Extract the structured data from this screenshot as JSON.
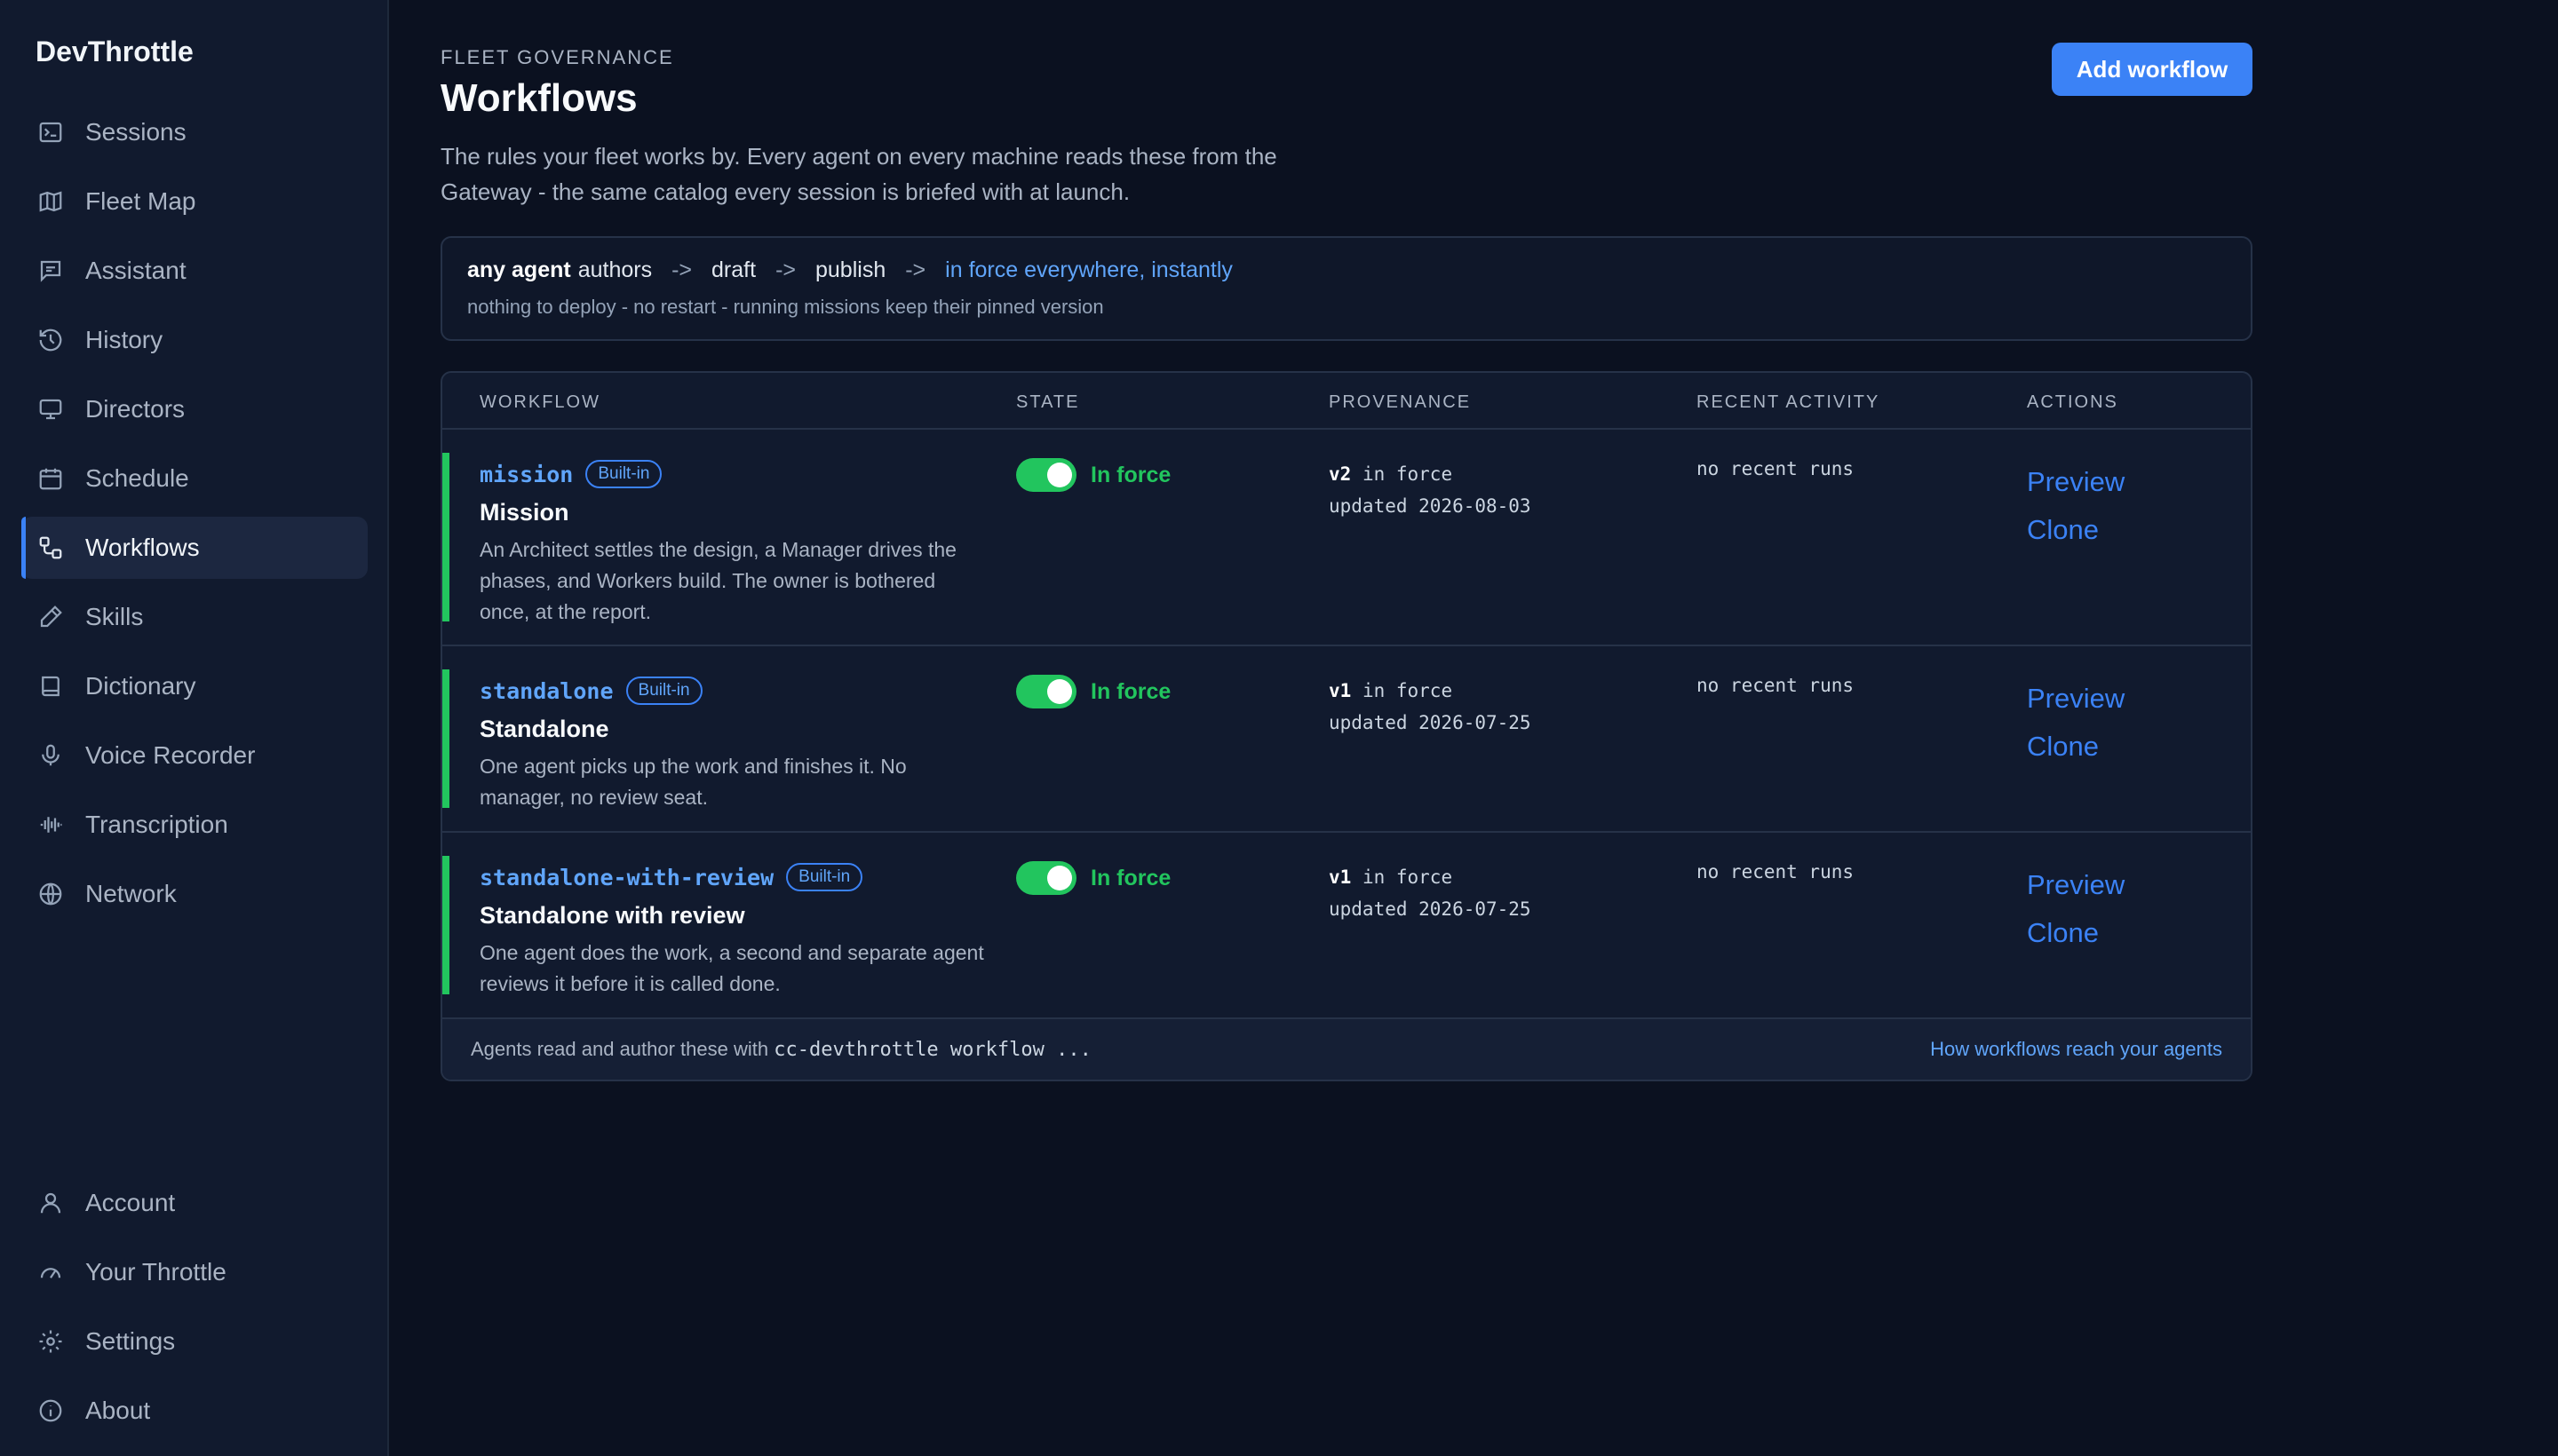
{
  "app": {
    "brand": "DevThrottle"
  },
  "sidebar": {
    "items": [
      {
        "label": "Sessions",
        "icon": "terminal-icon"
      },
      {
        "label": "Fleet Map",
        "icon": "map-icon"
      },
      {
        "label": "Assistant",
        "icon": "chat-icon"
      },
      {
        "label": "History",
        "icon": "history-icon"
      },
      {
        "label": "Directors",
        "icon": "monitor-icon"
      },
      {
        "label": "Schedule",
        "icon": "calendar-icon"
      },
      {
        "label": "Workflows",
        "icon": "workflow-icon",
        "active": true
      },
      {
        "label": "Skills",
        "icon": "pen-icon"
      },
      {
        "label": "Dictionary",
        "icon": "book-icon"
      },
      {
        "label": "Voice Recorder",
        "icon": "microphone-icon"
      },
      {
        "label": "Transcription",
        "icon": "waveform-icon"
      },
      {
        "label": "Network",
        "icon": "globe-icon"
      }
    ],
    "bottom_items": [
      {
        "label": "Account",
        "icon": "user-icon"
      },
      {
        "label": "Your Throttle",
        "icon": "gauge-icon"
      },
      {
        "label": "Settings",
        "icon": "gear-icon"
      },
      {
        "label": "About",
        "icon": "info-icon"
      }
    ]
  },
  "header": {
    "eyebrow": "FLEET GOVERNANCE",
    "title": "Workflows",
    "subtitle": "The rules your fleet works by. Every agent on every machine reads these from the Gateway - the same catalog every session is briefed with at launch.",
    "add_button": "Add workflow"
  },
  "flow": {
    "actor": "any agent",
    "step1": "authors",
    "arrow": "->",
    "step2": "draft",
    "step3": "publish",
    "result": "in force everywhere, instantly",
    "note": "nothing to deploy - no restart - running missions keep their pinned version"
  },
  "table": {
    "columns": [
      "WORKFLOW",
      "STATE",
      "PROVENANCE",
      "RECENT ACTIVITY",
      "ACTIONS"
    ],
    "rows": [
      {
        "slug": "mission",
        "badge": "Built-in",
        "title": "Mission",
        "description": "An Architect settles the design, a Manager drives the phases, and Workers build. The owner is bothered once, at the report.",
        "state": "In force",
        "enabled": true,
        "version": "v2",
        "version_suffix": " in force",
        "updated": "updated 2026-08-03",
        "recent": "no recent runs",
        "actions": [
          "Preview",
          "Clone"
        ]
      },
      {
        "slug": "standalone",
        "badge": "Built-in",
        "title": "Standalone",
        "description": "One agent picks up the work and finishes it. No manager, no review seat.",
        "state": "In force",
        "enabled": true,
        "version": "v1",
        "version_suffix": " in force",
        "updated": "updated 2026-07-25",
        "recent": "no recent runs",
        "actions": [
          "Preview",
          "Clone"
        ]
      },
      {
        "slug": "standalone-with-review",
        "badge": "Built-in",
        "title": "Standalone with review",
        "description": "One agent does the work, a second and separate agent reviews it before it is called done.",
        "state": "In force",
        "enabled": true,
        "version": "v1",
        "version_suffix": " in force",
        "updated": "updated 2026-07-25",
        "recent": "no recent runs",
        "actions": [
          "Preview",
          "Clone"
        ]
      }
    ],
    "footer_text": "Agents read and author these with ",
    "footer_code": "cc-devthrottle workflow ...",
    "footer_link": "How workflows reach your agents"
  },
  "colors": {
    "accent": "#3b82f6",
    "success": "#22c55e",
    "background": "#0b1120",
    "sidebar": "#111a2e"
  }
}
